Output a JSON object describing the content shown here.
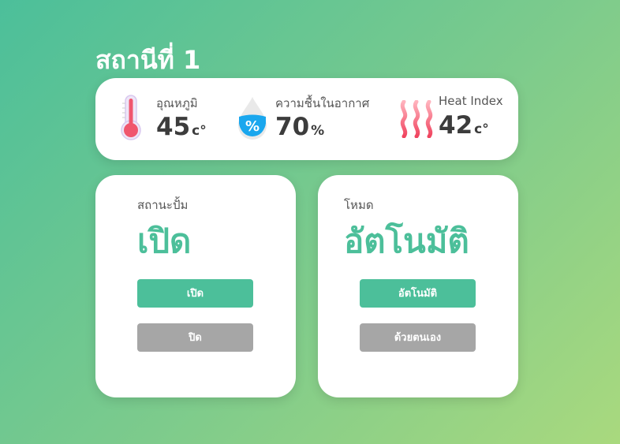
{
  "station": {
    "title": "สถานีที่ 1"
  },
  "sensors": {
    "temperature": {
      "label": "อุณหภูมิ",
      "value": "45",
      "unit": "c°",
      "icon": "thermometer-icon"
    },
    "humidity": {
      "label": "ความชื้นในอากาศ",
      "value": "70",
      "unit": "%",
      "icon": "humidity-drop-icon"
    },
    "heat_index": {
      "label": "Heat Index",
      "value": "42",
      "unit": "c°",
      "icon": "heat-waves-icon"
    }
  },
  "pump": {
    "label": "สถานะปั้ม",
    "status": "เปิด",
    "on_button": "เปิด",
    "off_button": "ปิด"
  },
  "mode": {
    "label": "โหมด",
    "status": "อัตโนมัติ",
    "auto_button": "อัตโนมัติ",
    "manual_button": "ด้วยตนเอง"
  },
  "colors": {
    "accent": "#4cbf9a",
    "button_gray": "#a6a6a6",
    "thermo_red": "#f0566e",
    "humidity_blue": "#1aa7ee"
  }
}
